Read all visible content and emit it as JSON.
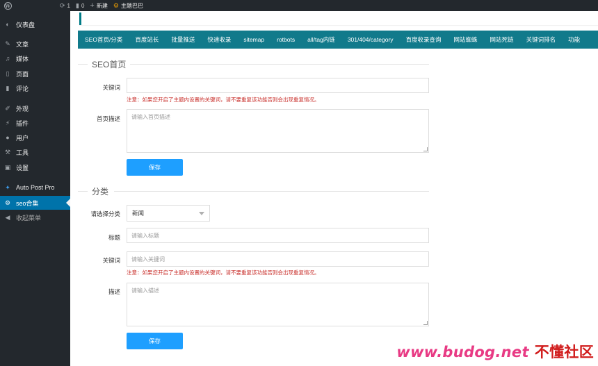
{
  "adminbar": {
    "updates_count": "1",
    "comments_count": "0",
    "new_label": "新建",
    "site_name": "主题巴巴"
  },
  "sidebar": {
    "items": [
      {
        "label": "仪表盘",
        "icon": "dashboard-icon"
      },
      {
        "label": "文章",
        "icon": "pin-icon"
      },
      {
        "label": "媒体",
        "icon": "media-icon"
      },
      {
        "label": "页面",
        "icon": "page-icon"
      },
      {
        "label": "评论",
        "icon": "comment-icon"
      },
      {
        "label": "外观",
        "icon": "brush-icon"
      },
      {
        "label": "插件",
        "icon": "plugin-icon"
      },
      {
        "label": "用户",
        "icon": "user-icon"
      },
      {
        "label": "工具",
        "icon": "wrench-icon"
      },
      {
        "label": "设置",
        "icon": "settings-icon"
      },
      {
        "label": "Auto Post Pro",
        "icon": "sparkle-icon"
      },
      {
        "label": "seo合集",
        "icon": "gear-icon"
      },
      {
        "label": "收起菜单",
        "icon": "collapse-icon"
      }
    ],
    "active_color": "#0073aa"
  },
  "tabs": [
    "SEO首页/分类",
    "百度站长",
    "批量推送",
    "快速收录",
    "sitemap",
    "rotbots",
    "all/tag内链",
    "301/404/category",
    "百度收录查询",
    "网站蜘蛛",
    "网站死链",
    "关键词排名",
    "功能"
  ],
  "seo_home": {
    "title": "SEO首页",
    "keyword_label": "关键词",
    "keyword_value": "",
    "warning": "注意：如果您开启了主题内设置的关键词，请不要重复该功能否则会出现重复情况。",
    "desc_label": "首页描述",
    "desc_placeholder": "请输入首页描述",
    "save_label": "保存"
  },
  "category": {
    "title": "分类",
    "select_label": "请选择分类",
    "select_value": "新闻",
    "title_label": "标题",
    "title_placeholder": "请输入标题",
    "keyword_label": "关键词",
    "keyword_placeholder": "请输入关键词",
    "warning": "注意：如果您开启了主题内设置的关键词，请不要重复该功能否则会出现重复情况。",
    "desc_label": "描述",
    "desc_placeholder": "请输入描述",
    "save_label": "保存"
  },
  "watermark": {
    "url": "www.budog.net",
    "cn": "不懂社区"
  },
  "colors": {
    "tabbar": "#117a8b",
    "button": "#1e9fff",
    "warning": "#c9302c",
    "watermark": "#e83a84"
  }
}
